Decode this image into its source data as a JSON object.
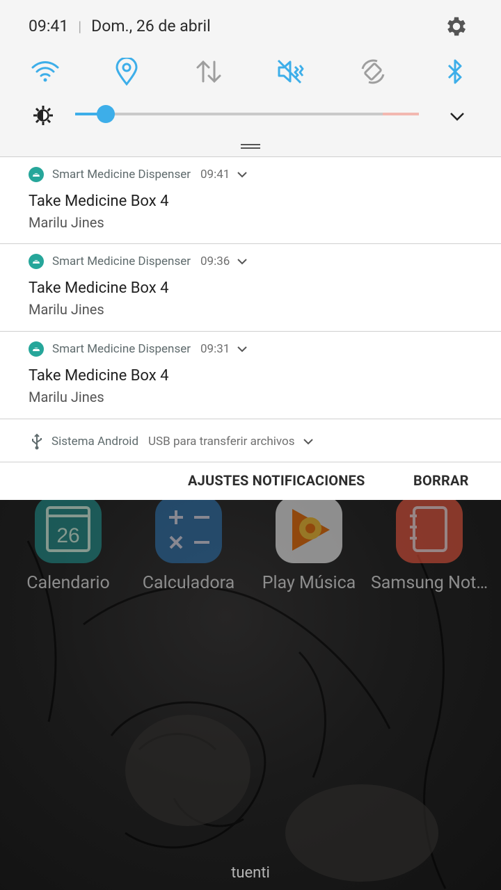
{
  "status": {
    "time": "09:41",
    "date": "Dom., 26 de abril"
  },
  "quick_settings": [
    {
      "icon": "wifi-icon",
      "active": true
    },
    {
      "icon": "location-icon",
      "active": true
    },
    {
      "icon": "mobile-data-icon",
      "active": false
    },
    {
      "icon": "sound-off-icon",
      "active": true
    },
    {
      "icon": "auto-rotate-icon",
      "active": false
    },
    {
      "icon": "bluetooth-icon",
      "active": true
    }
  ],
  "brightness": {
    "level_fraction": 0.06
  },
  "notifications": [
    {
      "app": "Smart Medicine Dispenser",
      "time": "09:41",
      "title": "Take Medicine Box 4",
      "text": "Marilu Jines"
    },
    {
      "app": "Smart Medicine Dispenser",
      "time": "09:36",
      "title": "Take Medicine Box 4",
      "text": "Marilu Jines"
    },
    {
      "app": "Smart Medicine Dispenser",
      "time": "09:31",
      "title": "Take Medicine Box 4",
      "text": "Marilu Jines"
    }
  ],
  "system_notification": {
    "app": "Sistema Android",
    "text": "USB para transferir archivos"
  },
  "actions": {
    "settings": "AJUSTES NOTIFICACIONES",
    "clear": "BORRAR"
  },
  "home_apps": [
    {
      "label": "Calendario",
      "icon": "calendar-icon",
      "badge": "26"
    },
    {
      "label": "Calculadora",
      "icon": "calculator-icon"
    },
    {
      "label": "Play Música",
      "icon": "play-music-icon"
    },
    {
      "label": "Samsung Not…",
      "icon": "samsung-notes-icon"
    }
  ],
  "carrier": "tuenti",
  "colors": {
    "accent": "#3daee9",
    "inactive_icon": "#9e9e9e",
    "shade_bg": "#f5f5f5",
    "app_icon": "#26a69a"
  }
}
